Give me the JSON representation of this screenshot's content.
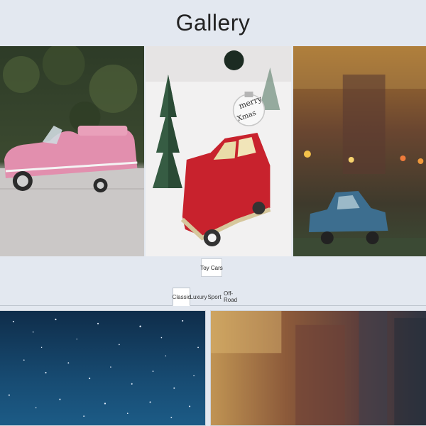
{
  "page": {
    "title": "Gallery"
  },
  "gallery": {
    "images": [
      {
        "name": "pink-convertible-toy-car-photo",
        "alt": "Pink classic convertible toy car"
      },
      {
        "name": "red-christmas-toy-truck-photo",
        "alt": "Red toy truck with Merry Xmas ornament"
      },
      {
        "name": "blue-vintage-toy-car-photo",
        "alt": "Blue vintage toy car at dusk"
      }
    ],
    "caption_button": "Toy Cars"
  },
  "tabs": {
    "items": [
      {
        "label": "Classic",
        "active": true
      },
      {
        "label": "Luxury",
        "active": false
      },
      {
        "label": "Sport",
        "active": false
      },
      {
        "label": "Off-Road",
        "active": false
      }
    ]
  },
  "cards": [
    {
      "name": "starry-night-sky-photo"
    },
    {
      "name": "blurred-dusk-street-photo"
    }
  ],
  "ornament_text": [
    "merry",
    "Xmas"
  ],
  "colors": {
    "background": "#e3e8f0",
    "panel": "#ffffff",
    "border": "#bcc3cc"
  }
}
